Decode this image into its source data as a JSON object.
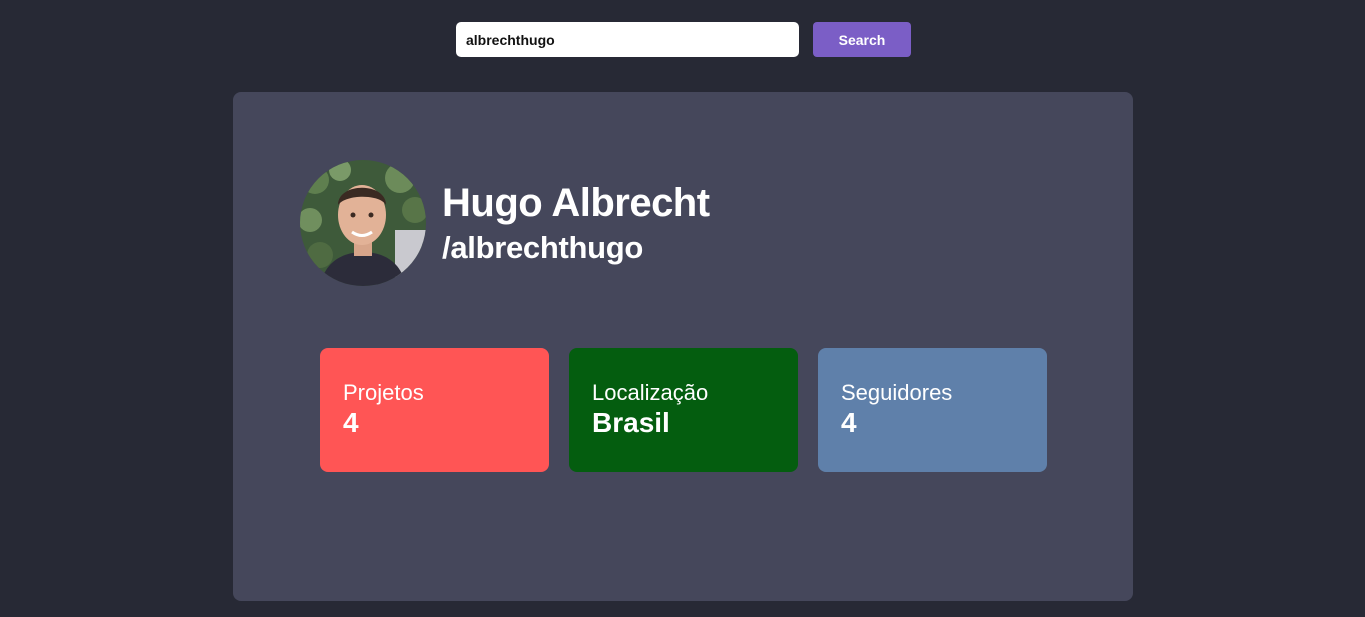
{
  "search": {
    "value": "albrechthugo",
    "button_label": "Search"
  },
  "profile": {
    "name": "Hugo Albrecht",
    "username": "/albrechthugo"
  },
  "stats": [
    {
      "label": "Projetos",
      "value": "4",
      "color": "#ff5555"
    },
    {
      "label": "Localização",
      "value": "Brasil",
      "color": "#045d0f"
    },
    {
      "label": "Seguidores",
      "value": "4",
      "color": "#5f80aa"
    }
  ],
  "colors": {
    "background": "#272935",
    "card": "#45475b",
    "accent": "#7b5ec6"
  }
}
